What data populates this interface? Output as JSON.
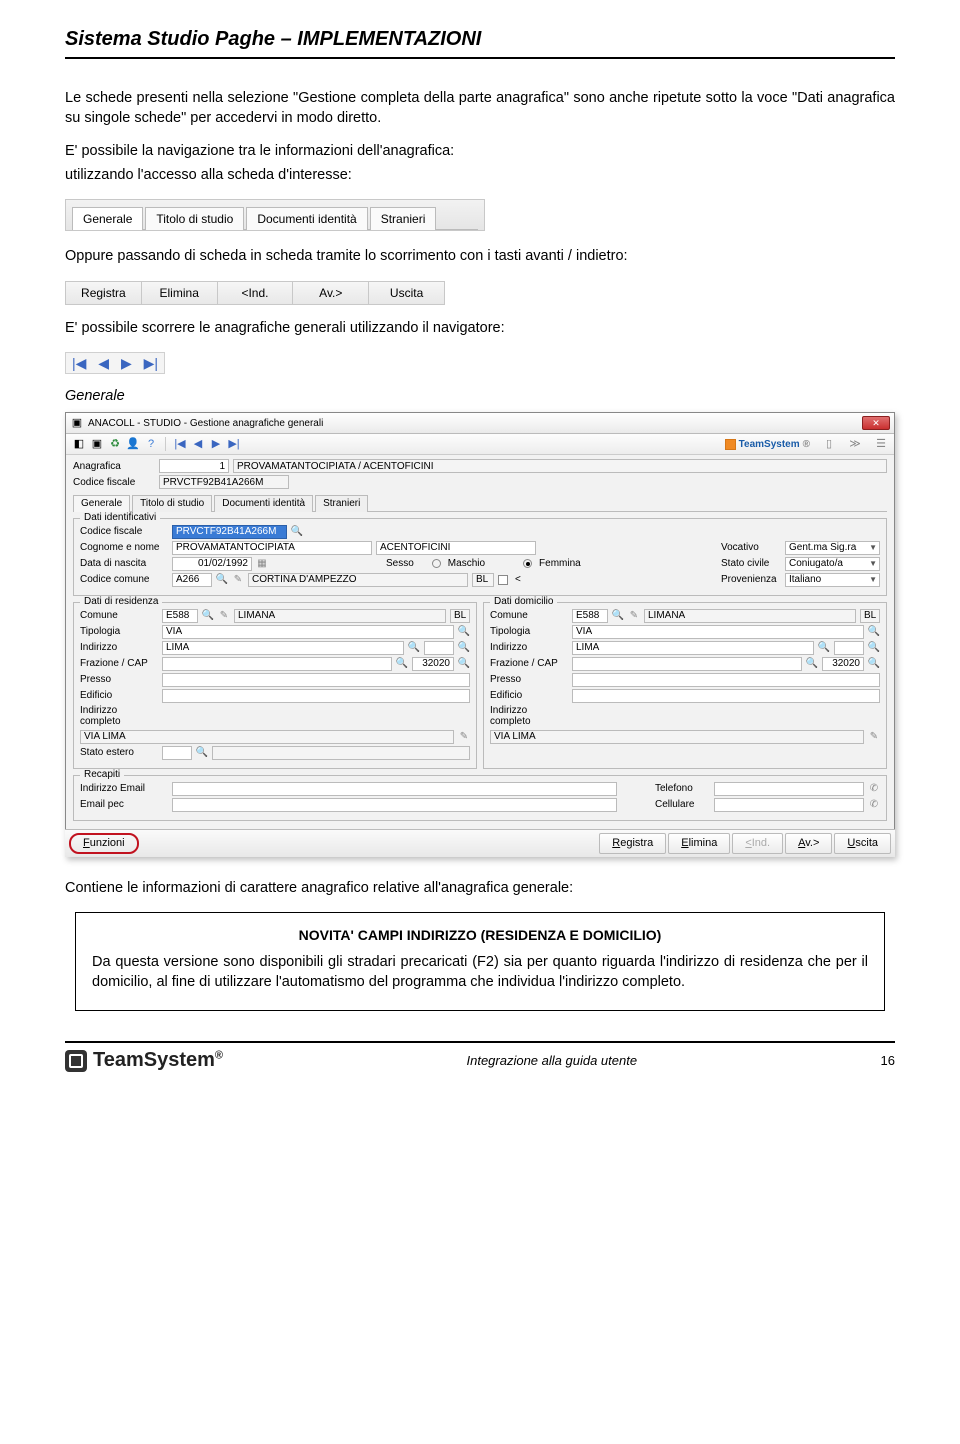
{
  "header": {
    "title": "Sistema Studio Paghe – IMPLEMENTAZIONI"
  },
  "para1": "Le schede presenti nella selezione \"Gestione completa della parte anagrafica\" sono anche ripetute sotto la voce \"Dati anagrafica su singole schede\" per accedervi in modo diretto.",
  "para2": "E' possibile la navigazione tra le informazioni dell'anagrafica:",
  "para3": "utilizzando l'accesso alla scheda d'interesse:",
  "tabs1": {
    "t0": "Generale",
    "t1": "Titolo di studio",
    "t2": "Documenti identità",
    "t3": "Stranieri"
  },
  "para4": "Oppure passando di scheda in scheda tramite lo scorrimento con i tasti avanti / indietro:",
  "btns": {
    "b0": "Registra",
    "b1": "Elimina",
    "b2": "<Ind.",
    "b3": "Av.>",
    "b4": "Uscita"
  },
  "para5": "E' possibile scorrere le anagrafiche generali utilizzando il navigatore:",
  "navicons": {
    "first": "|◀",
    "prev": "◀",
    "next": "▶",
    "last": "▶|"
  },
  "sectionLabel": "Generale",
  "win": {
    "title": "ANACOLL - STUDIO - Gestione anagrafiche generali",
    "brand": "TeamSystem",
    "header": {
      "anagrafica_lbl": "Anagrafica",
      "anagrafica_val": "1",
      "anagrafica_name": "PROVAMATANTOCIPIATA / ACENTOFICINI",
      "cf_lbl": "Codice fiscale",
      "cf_val": "PRVCTF92B41A266M"
    },
    "tabs": {
      "t0": "Generale",
      "t1": "Titolo di studio",
      "t2": "Documenti identità",
      "t3": "Stranieri"
    },
    "grp_id": {
      "title": "Dati identificativi",
      "cf_lbl": "Codice fiscale",
      "cf_val": "PRVCTF92B41A266M",
      "cogn_lbl": "Cognome e nome",
      "cogn_val": "PROVAMATANTOCIPIATA",
      "nome_val": "ACENTOFICINI",
      "voc_lbl": "Vocativo",
      "voc_val": "Gent.ma Sig.ra",
      "dn_lbl": "Data di nascita",
      "dn_val": "01/02/1992",
      "sesso_lbl": "Sesso",
      "m": "Maschio",
      "f": "Femmina",
      "sc_lbl": "Stato civile",
      "sc_val": "Coniugato/a",
      "cc_lbl": "Codice comune",
      "cc_val": "A266",
      "cc_name": "CORTINA D'AMPEZZO",
      "cc_prov": "BL",
      "lt": "<",
      "prov_lbl": "Provenienza",
      "prov_val": "Italiano"
    },
    "grp_res": {
      "title": "Dati di residenza",
      "comune_lbl": "Comune",
      "comune_val": "E588",
      "comune_name": "LIMANA",
      "comune_prov": "BL",
      "tip_lbl": "Tipologia",
      "tip_val": "VIA",
      "ind_lbl": "Indirizzo",
      "ind_val": "LIMA",
      "fraz_lbl": "Frazione / CAP",
      "cap_val": "32020",
      "presso_lbl": "Presso",
      "edif_lbl": "Edificio",
      "indc_lbl": "Indirizzo completo",
      "indc_val": "VIA LIMA",
      "stato_lbl": "Stato estero"
    },
    "grp_dom": {
      "title": "Dati domicilio",
      "comune_lbl": "Comune",
      "comune_val": "E588",
      "comune_name": "LIMANA",
      "comune_prov": "BL",
      "tip_lbl": "Tipologia",
      "tip_val": "VIA",
      "ind_lbl": "Indirizzo",
      "ind_val": "LIMA",
      "fraz_lbl": "Frazione / CAP",
      "cap_val": "32020",
      "presso_lbl": "Presso",
      "edif_lbl": "Edificio",
      "indc_lbl": "Indirizzo completo",
      "indc_val": "VIA LIMA"
    },
    "grp_rec": {
      "title": "Recapiti",
      "email_lbl": "Indirizzo Email",
      "pec_lbl": "Email pec",
      "tel_lbl": "Telefono",
      "cell_lbl": "Cellulare"
    },
    "bottom": {
      "funzioni": "Funzioni",
      "registra": "Registra",
      "elimina": "Elimina",
      "ind": "<Ind.",
      "av": "Av.>",
      "uscita": "Uscita"
    }
  },
  "para6": "Contiene le informazioni di carattere anagrafico relative all'anagrafica generale:",
  "novita": {
    "title": "NOVITA' CAMPI INDIRIZZO (RESIDENZA E DOMICILIO)",
    "text": "Da questa versione sono disponibili gli stradari precaricati (F2) sia per quanto riguarda l'indirizzo di residenza che per il domicilio, al fine di utilizzare l'automatismo del programma che individua l'indirizzo completo."
  },
  "footer": {
    "brand": "TeamSystem",
    "line": "Integrazione alla guida utente",
    "page": "16"
  }
}
